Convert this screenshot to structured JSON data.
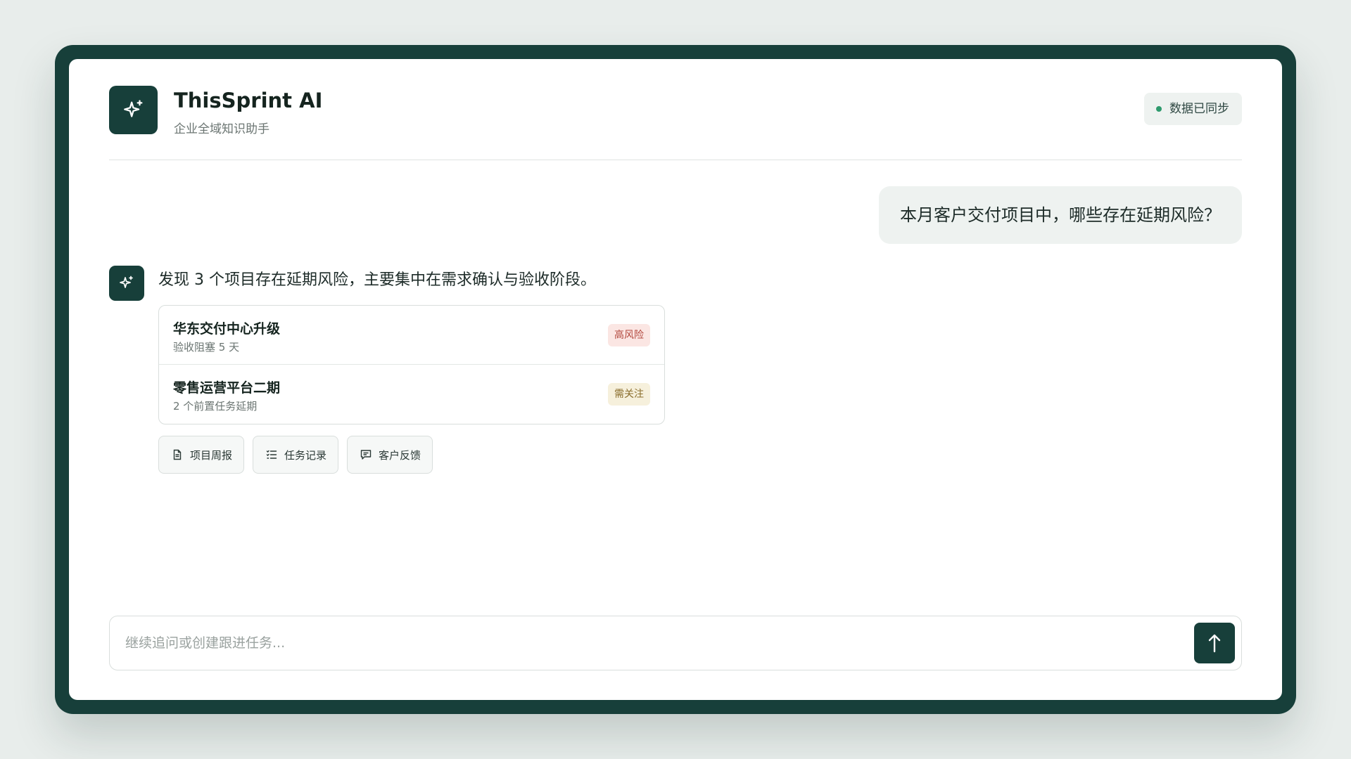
{
  "app": {
    "title": "ThisSprint AI",
    "subtitle": "企业全域知识助手",
    "sync_status": "数据已同步",
    "logo_icon": "sparkle-icon"
  },
  "conversation": {
    "user_message": "本月客户交付项目中，哪些存在延期风险？",
    "ai_message": "发现 3 个项目存在延期风险，主要集中在需求确认与验收阶段。",
    "projects": [
      {
        "name": "华东交付中心升级",
        "note": "验收阻塞 5 天",
        "tag": "高风险",
        "tag_color": "#b2473d"
      },
      {
        "name": "零售运营平台二期",
        "note": "2 个前置任务延期",
        "tag": "需关注",
        "tag_color": "#8a6d2c"
      }
    ],
    "sources": [
      {
        "label": "项目周报",
        "icon": "document-icon"
      },
      {
        "label": "任务记录",
        "icon": "checklist-icon"
      },
      {
        "label": "客户反馈",
        "icon": "comment-icon"
      }
    ]
  },
  "composer": {
    "placeholder": "继续追问或创建跟进任务...",
    "send_icon": "arrow-up-icon"
  },
  "colors": {
    "brand": "#173f3a",
    "sync_dot": "#2e9a6d"
  }
}
